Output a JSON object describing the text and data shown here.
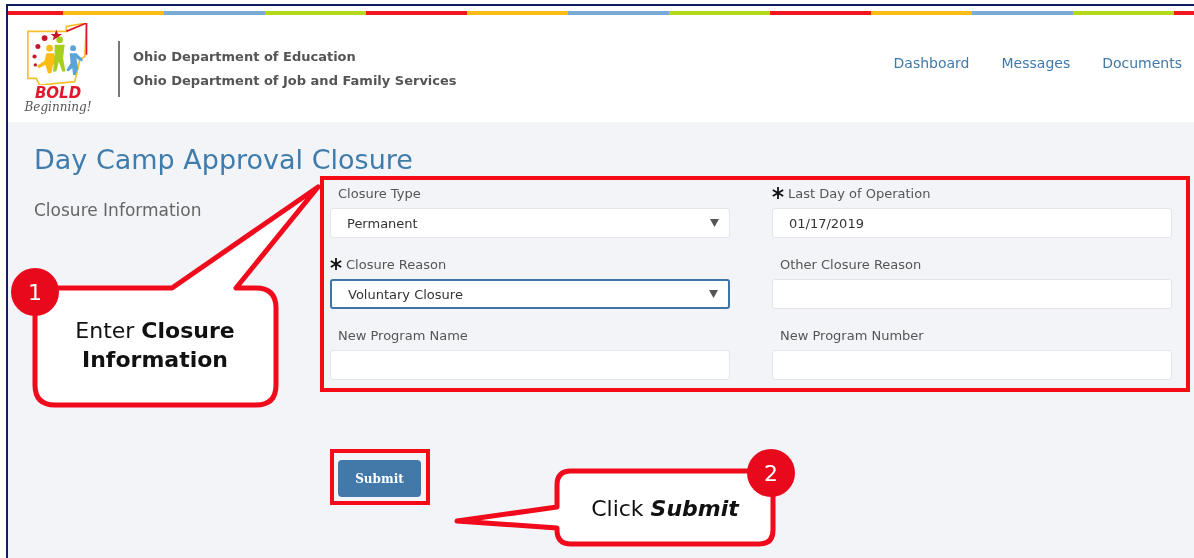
{
  "header": {
    "logo": {
      "title": "BOLD",
      "subtitle": "Beginning!"
    },
    "organizations": [
      "Ohio Department of Education",
      "Ohio Department of Job and Family Services"
    ],
    "nav": [
      {
        "label": "Dashboard"
      },
      {
        "label": "Messages"
      },
      {
        "label": "Documents"
      }
    ]
  },
  "page": {
    "title": "Day Camp Approval Closure",
    "section": "Closure Information"
  },
  "form": {
    "highlighted": true,
    "fields": [
      {
        "kind": "select",
        "label": "Closure Type",
        "required": false,
        "value": "Permanent",
        "focused": false
      },
      {
        "kind": "text",
        "label": "Last Day of Operation",
        "required": true,
        "value": "01/17/2019",
        "focused": false
      },
      {
        "kind": "select",
        "label": "Closure Reason",
        "required": true,
        "value": "Voluntary Closure",
        "focused": true
      },
      {
        "kind": "text",
        "label": "Other Closure Reason",
        "required": false,
        "focused": false
      },
      {
        "kind": "text",
        "label": "New Program Name",
        "required": false,
        "focused": false
      },
      {
        "kind": "text",
        "label": "New Program Number",
        "required": false,
        "focused": false
      }
    ]
  },
  "submit": {
    "label": "Submit",
    "highlighted": true
  },
  "callouts": [
    {
      "number": "1",
      "text": "Enter **Closure Information**"
    },
    {
      "number": "2",
      "text": "Click **Submit**"
    }
  ]
}
